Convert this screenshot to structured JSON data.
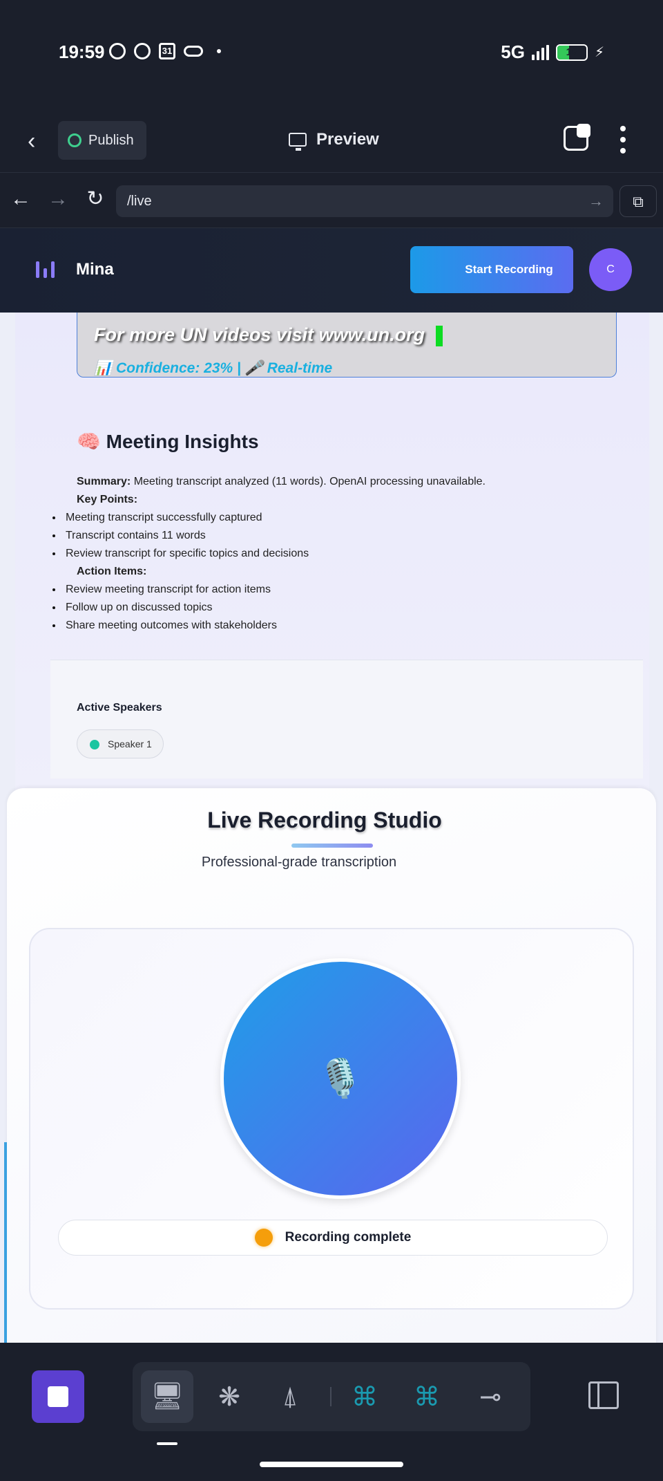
{
  "status_bar": {
    "time": "19:59",
    "calendar_day": "31",
    "network": "5G",
    "battery": "18"
  },
  "app_header": {
    "publish_label": "Publish",
    "preview_label": "Preview"
  },
  "url_bar": {
    "url": "/live"
  },
  "web_header": {
    "brand": "Mina",
    "start_recording": "Start Recording",
    "avatar_initial": "C"
  },
  "caption": {
    "text": "For more UN videos visit www.un.org",
    "confidence_line": "📊 Confidence: 23% | 🎤 Real-time"
  },
  "insights": {
    "title": "🧠 Meeting Insights",
    "summary_label": "Summary:",
    "summary_text": " Meeting transcript analyzed (11 words). OpenAI processing unavailable.",
    "key_points_label": "Key Points:",
    "key_points": [
      "Meeting transcript successfully captured",
      "Transcript contains 11 words",
      "Review transcript for specific topics and decisions"
    ],
    "action_items_label": "Action Items:",
    "action_items": [
      "Review meeting transcript for action items",
      "Follow up on discussed topics",
      "Share meeting outcomes with stakeholders"
    ]
  },
  "speakers": {
    "title": "Active Speakers",
    "items": [
      "Speaker 1"
    ]
  },
  "studio": {
    "title": "Live Recording Studio",
    "subtitle": "Professional-grade transcription",
    "mic_glyph": "🎙️",
    "status": "Recording complete"
  },
  "colors": {
    "accent": "#1c9ae8",
    "accent2": "#5b6cf0",
    "status_dot": "#f59e0b",
    "speaker_dot": "#1bc5a0"
  },
  "dock": {
    "icons": [
      "stop-icon",
      "desktop-icon",
      "apps-icon",
      "antenna-icon",
      "python-icon",
      "python-icon",
      "share-icon",
      "side-panel-icon"
    ]
  }
}
